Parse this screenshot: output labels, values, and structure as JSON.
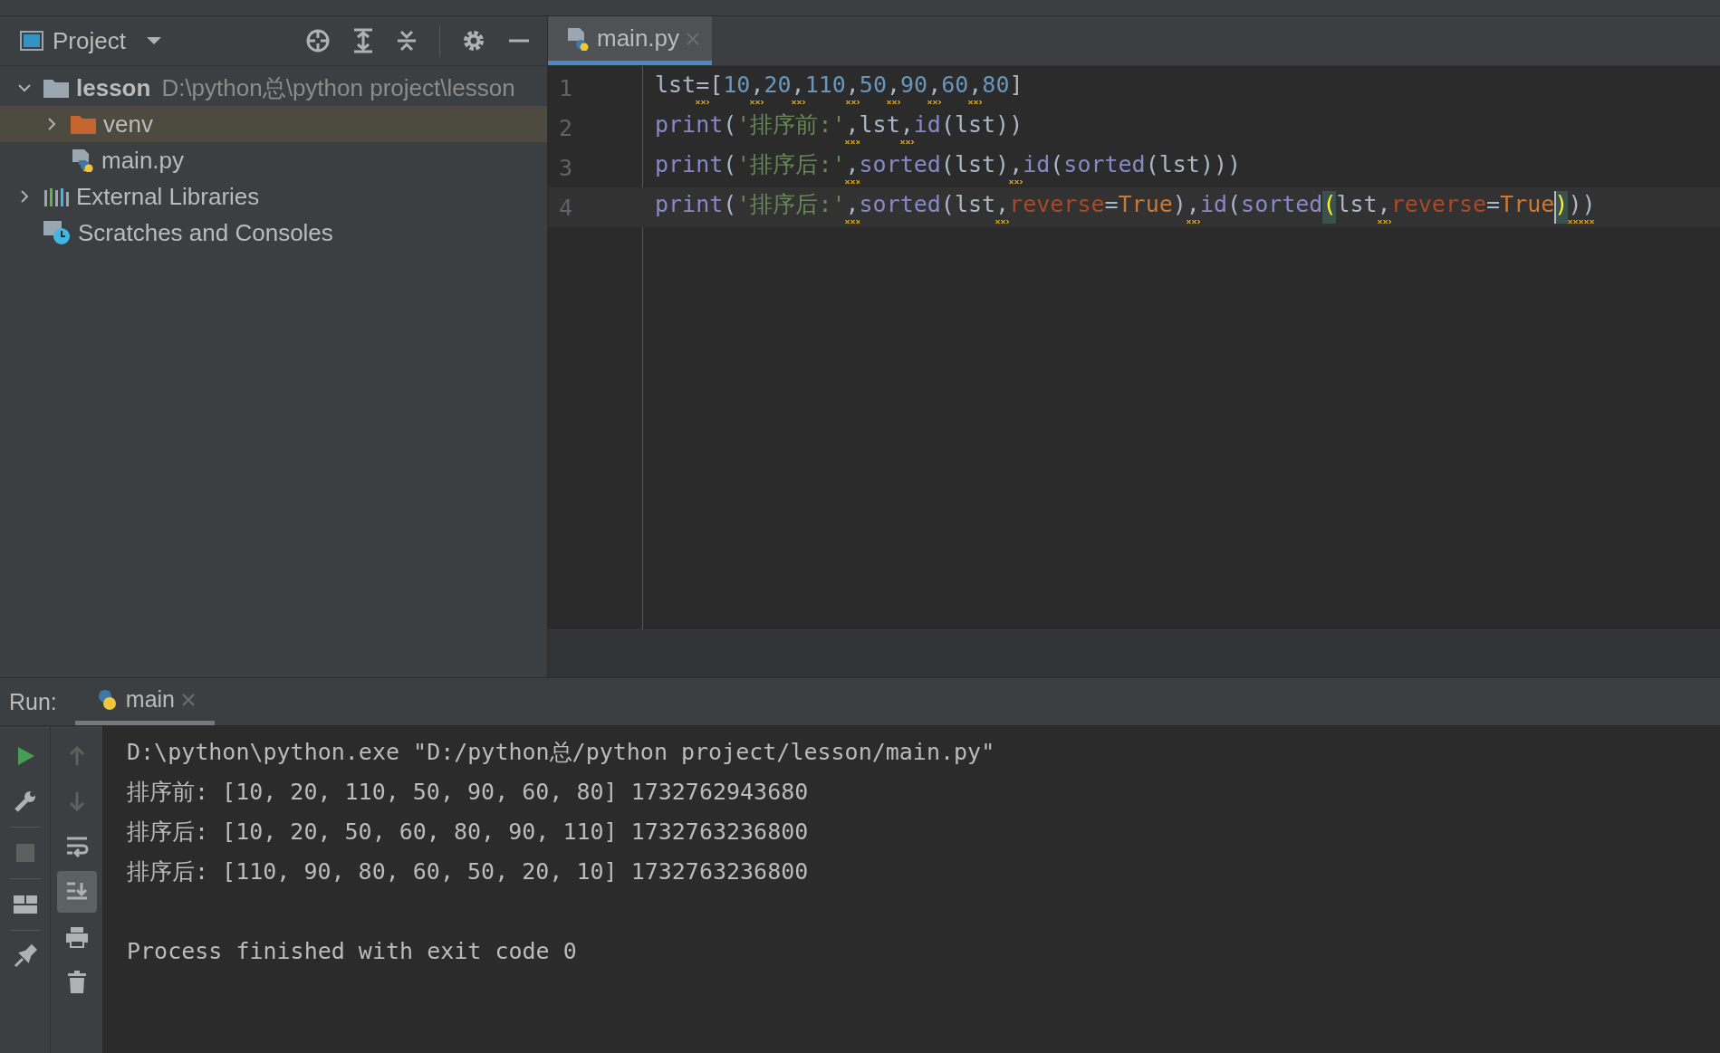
{
  "project_panel": {
    "title": "Project",
    "tree": [
      {
        "label": "lesson",
        "kind": "folder",
        "detail": "D:\\python总\\python project\\lesson",
        "expanded": true,
        "selected": false,
        "children": [
          {
            "label": "venv",
            "kind": "venv",
            "expanded": false,
            "selected": true
          },
          {
            "label": "main.py",
            "kind": "python",
            "selected": false
          }
        ]
      },
      {
        "label": "External Libraries",
        "kind": "libraries",
        "expanded": false,
        "selected": false
      },
      {
        "label": "Scratches and Consoles",
        "kind": "scratches",
        "selected": false
      }
    ]
  },
  "editor": {
    "tabs": [
      {
        "label": "main.py",
        "selected": true
      }
    ],
    "lines": [
      {
        "number": "1",
        "current": false,
        "tokens": [
          {
            "text": "lst",
            "kind": "plain",
            "warning": false
          },
          {
            "text": "=",
            "kind": "plain",
            "warning": true
          },
          {
            "text": "[",
            "kind": "plain",
            "warning": false
          },
          {
            "text": "10",
            "kind": "number",
            "warning": false
          },
          {
            "text": ",",
            "kind": "plain",
            "warning": true
          },
          {
            "text": "20",
            "kind": "number",
            "warning": false
          },
          {
            "text": ",",
            "kind": "plain",
            "warning": true
          },
          {
            "text": "110",
            "kind": "number",
            "warning": false
          },
          {
            "text": ",",
            "kind": "plain",
            "warning": true
          },
          {
            "text": "50",
            "kind": "number",
            "warning": false
          },
          {
            "text": ",",
            "kind": "plain",
            "warning": true
          },
          {
            "text": "90",
            "kind": "number",
            "warning": false
          },
          {
            "text": ",",
            "kind": "plain",
            "warning": true
          },
          {
            "text": "60",
            "kind": "number",
            "warning": false
          },
          {
            "text": ",",
            "kind": "plain",
            "warning": true
          },
          {
            "text": "80",
            "kind": "number",
            "warning": false
          },
          {
            "text": "]",
            "kind": "plain",
            "warning": false
          }
        ]
      },
      {
        "number": "2",
        "current": false,
        "tokens": [
          {
            "text": "print",
            "kind": "builtin",
            "warning": false
          },
          {
            "text": "(",
            "kind": "plain",
            "warning": false
          },
          {
            "text": "'排序前:'",
            "kind": "string",
            "warning": false
          },
          {
            "text": ",",
            "kind": "plain",
            "warning": true
          },
          {
            "text": "lst",
            "kind": "plain",
            "warning": false
          },
          {
            "text": ",",
            "kind": "plain",
            "warning": true
          },
          {
            "text": "id",
            "kind": "builtin",
            "warning": false
          },
          {
            "text": "(lst))",
            "kind": "plain",
            "warning": false
          }
        ]
      },
      {
        "number": "3",
        "current": false,
        "tokens": [
          {
            "text": "print",
            "kind": "builtin",
            "warning": false
          },
          {
            "text": "(",
            "kind": "plain",
            "warning": false
          },
          {
            "text": "'排序后:'",
            "kind": "string",
            "warning": false
          },
          {
            "text": ",",
            "kind": "plain",
            "warning": true
          },
          {
            "text": "sorted",
            "kind": "builtin",
            "warning": false
          },
          {
            "text": "(lst)",
            "kind": "plain",
            "warning": false
          },
          {
            "text": ",",
            "kind": "plain",
            "warning": true
          },
          {
            "text": "id",
            "kind": "builtin",
            "warning": false
          },
          {
            "text": "(",
            "kind": "plain",
            "warning": false
          },
          {
            "text": "sorted",
            "kind": "builtin",
            "warning": false
          },
          {
            "text": "(lst)))",
            "kind": "plain",
            "warning": false
          }
        ]
      },
      {
        "number": "4",
        "current": true,
        "tokens": [
          {
            "text": "print",
            "kind": "builtin",
            "warning": false
          },
          {
            "text": "(",
            "kind": "plain",
            "warning": false
          },
          {
            "text": "'排序后:'",
            "kind": "string",
            "warning": false
          },
          {
            "text": ",",
            "kind": "plain",
            "warning": true
          },
          {
            "text": "sorted",
            "kind": "builtin",
            "warning": false
          },
          {
            "text": "(lst",
            "kind": "plain",
            "warning": false
          },
          {
            "text": ",",
            "kind": "plain",
            "warning": true
          },
          {
            "text": "reverse",
            "kind": "param",
            "warning": false
          },
          {
            "text": "=",
            "kind": "plain",
            "warning": false
          },
          {
            "text": "True",
            "kind": "keyword",
            "warning": false
          },
          {
            "text": ")",
            "kind": "plain",
            "warning": false
          },
          {
            "text": ",",
            "kind": "plain",
            "warning": true
          },
          {
            "text": "id",
            "kind": "builtin",
            "warning": false
          },
          {
            "text": "(",
            "kind": "plain",
            "warning": false
          },
          {
            "text": "sorted",
            "kind": "builtin",
            "warning": false
          },
          {
            "text": "(",
            "kind": "brace",
            "warning": false
          },
          {
            "text": "lst",
            "kind": "plain",
            "warning": false
          },
          {
            "text": ",",
            "kind": "plain",
            "warning": true
          },
          {
            "text": "reverse",
            "kind": "param",
            "warning": false
          },
          {
            "text": "=",
            "kind": "plain",
            "warning": false
          },
          {
            "text": "True",
            "kind": "keyword",
            "warning": false
          },
          {
            "text": ")",
            "kind": "brace",
            "warning": false
          },
          {
            "text": "))",
            "kind": "plain",
            "warning": true
          }
        ]
      }
    ]
  },
  "run_panel": {
    "label": "Run:",
    "tabs": [
      {
        "label": "main",
        "selected": true
      }
    ],
    "left_tools": [
      {
        "disabled": false
      },
      {
        "disabled": false
      },
      {
        "disabled": true
      },
      {
        "disabled": false
      },
      {
        "disabled": false
      }
    ],
    "right_tools": [
      {
        "disabled": true,
        "selected": false
      },
      {
        "disabled": true,
        "selected": false
      },
      {
        "disabled": false,
        "selected": false
      },
      {
        "disabled": false,
        "selected": true
      },
      {
        "disabled": false,
        "selected": false
      },
      {
        "disabled": false,
        "selected": false
      }
    ],
    "console": [
      {
        "text": "D:\\python\\python.exe \"D:/python总/python project/lesson/main.py\"",
        "kind": "command"
      },
      {
        "text": "排序前: [10, 20, 110, 50, 90, 60, 80] 1732762943680",
        "kind": "output"
      },
      {
        "text": "排序后: [10, 20, 50, 60, 80, 90, 110] 1732763236800",
        "kind": "output"
      },
      {
        "text": "排序后: [110, 90, 80, 60, 50, 20, 10] 1732763236800",
        "kind": "output"
      },
      {
        "text": "Process finished with exit code 0",
        "kind": "exit"
      }
    ]
  }
}
